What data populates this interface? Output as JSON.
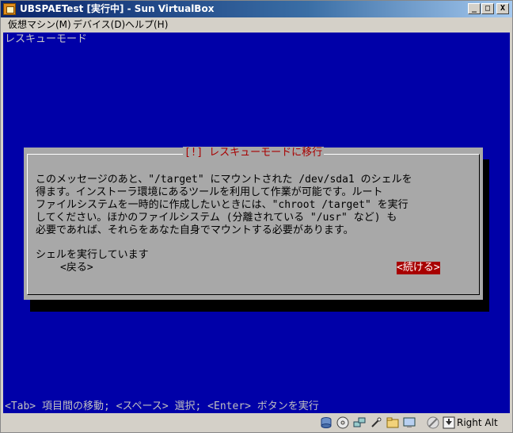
{
  "window": {
    "title": "UBSPAETest [実行中] - Sun VirtualBox",
    "min_label": "_",
    "max_label": "□",
    "close_label": "X"
  },
  "menu": [
    {
      "label": "仮想マシン(M)"
    },
    {
      "label": "デバイス(D)"
    },
    {
      "label": "ヘルプ(H)"
    }
  ],
  "screen": {
    "top_title": "レスキューモード",
    "dialog": {
      "title": "[!] レスキューモードに移行",
      "body": "このメッセージのあと、\"/target\" にマウントされた /dev/sda1 のシェルを\n得ます。インストーラ環境にあるツールを利用して作業が可能です。ルート\nファイルシステムを一時的に作成したいときには、\"chroot /target\" を実行\nしてください。ほかのファイルシステム (分離されている \"/usr\" など) も\n必要であれば、それらをあなた自身でマウントする必要があります。",
      "status": "シェルを実行しています",
      "back_button": "<戻る>",
      "continue_button": "<続ける>"
    },
    "help_line": "<Tab> 項目間の移動; <スペース> 選択; <Enter> ボタンを実行"
  },
  "statusbar": {
    "icons": [
      "hard-disk-icon",
      "cd-icon",
      "network-icon",
      "usb-icon",
      "shared-folder-icon",
      "display-icon",
      "mouse-integration-icon",
      "keyboard-capture-icon"
    ],
    "host_key": "Right Alt"
  }
}
